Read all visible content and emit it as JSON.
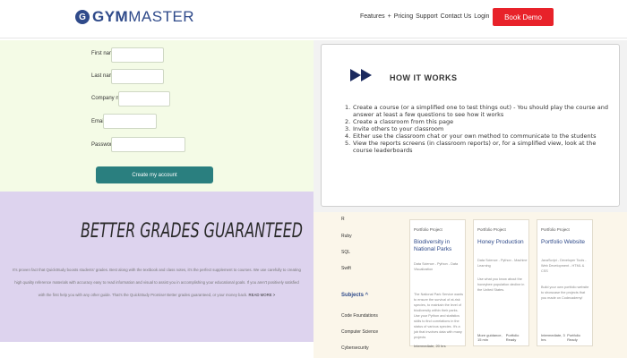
{
  "header": {
    "logo_text_bold": "GYM",
    "logo_text": "MASTER",
    "logo_mark": "G",
    "nav": [
      "Features",
      "Pricing",
      "Support",
      "Contact Us",
      "Login"
    ],
    "demo_button": "Book Demo",
    "accent": "#e8222a",
    "brand": "#2f4a8a"
  },
  "signup": {
    "labels": [
      "First name",
      "Last name",
      "Company name",
      "Email",
      "Password"
    ],
    "submit": "Create my account",
    "button_color": "#2a7f7f"
  },
  "how_it_works": {
    "title": "HOW IT WORKS",
    "steps": [
      "Create a course (or a simplified one to test things out) - You should play the course and answer at least a few questions to see how it works",
      "Create a classroom from this page",
      "Invite others to your classroom",
      "Either use the classroom chat or your own method to communicate to the students",
      "View the reports screens (in classroom reports) or, for a simplified view, look at the course leaderboards"
    ]
  },
  "grades": {
    "title": "BETTER GRADES GUARANTEED",
    "body": "It's proven fact that QuickStudy boosts students' grades. Best along with the textbook and class notes, it's the perfect supplement to courses. We use carefully to creating high quality reference materials with accuracy easy to read information and visual to assist you in accomplishing your educational goals. If you aren't positively satisfied with the first help you with any other guide. That's the QuickStudy Promise! Better grades guaranteed, or your money back.",
    "read_more": "READ MORE >"
  },
  "portfolio": {
    "side_items": [
      "R",
      "Ruby",
      "SQL",
      "Swift"
    ],
    "subjects_heading": "Subjects ^",
    "subjects": [
      "Code Foundations",
      "Computer Science",
      "Cybersecurity"
    ],
    "cards": [
      {
        "kind": "Portfolio Project",
        "title": "Biodiversity in National Parks",
        "meta": "Data Science - Python - Data Visualization",
        "desc": "The National Park Service wants to ensure the survival of at-risk species, to maintain the level of biodiversity within their parks. Use your Python and statistics skills to find correlations in the status of various species. It's a job that involves data with many projects",
        "footer_left": "Intermediate, 20 hrs",
        "footer_right": ""
      },
      {
        "kind": "Portfolio Project",
        "title": "Honey Production",
        "meta": "Data Science - Python - Machine Learning",
        "desc": "Use what you know about the honeybee population decline in the United States.",
        "footer_left": "More guidance, 15 min",
        "footer_right": "Portfolio Ready"
      },
      {
        "kind": "Portfolio Project",
        "title": "Portfolio Website",
        "meta": "JavaScript - Developer Tools - Web Development - HTML & CSS",
        "desc": "Build your own portfolio website to showcase the projects that you made on Codecademy!",
        "footer_left": "Intermediate, 3 hrs",
        "footer_right": "Portfolio Ready"
      }
    ]
  }
}
